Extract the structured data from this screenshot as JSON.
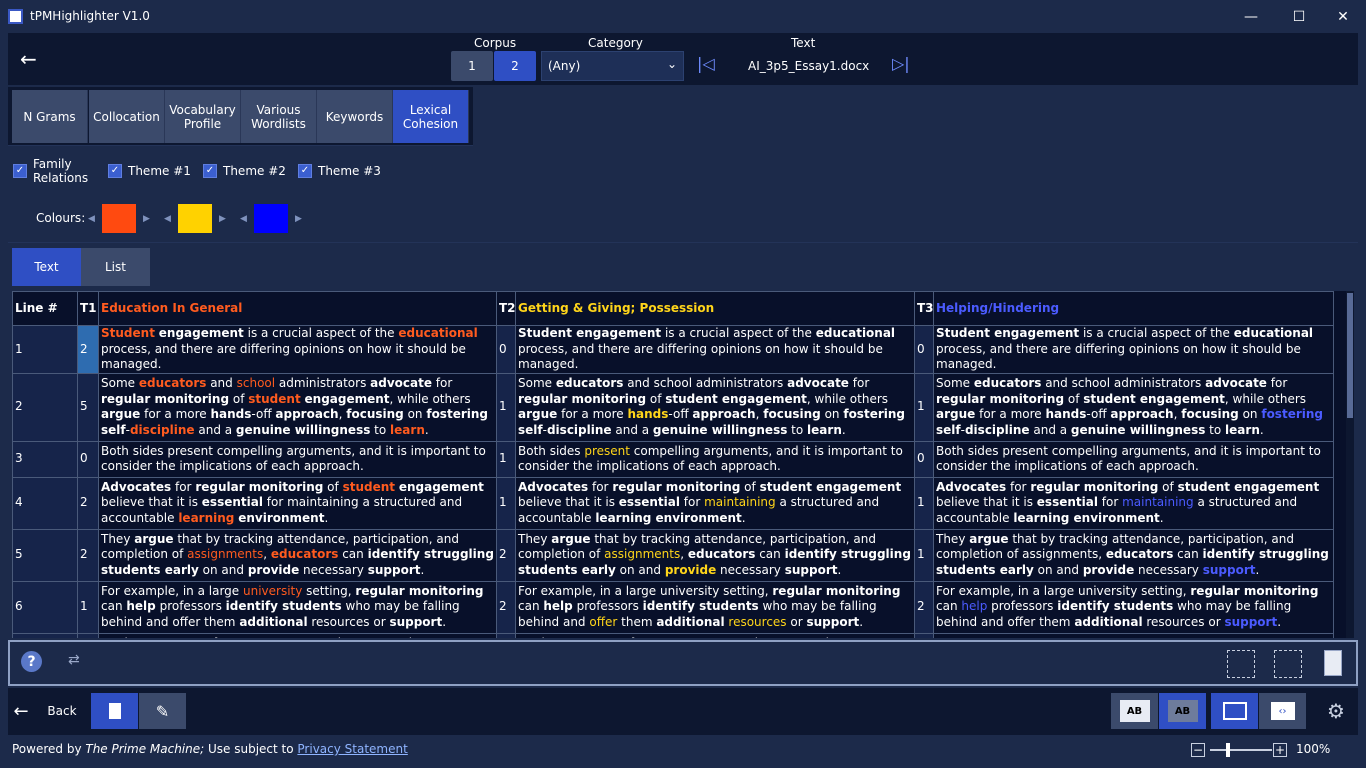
{
  "window": {
    "title": "tPMHighlighter V1.0",
    "minimize": "—",
    "maximize": "☐",
    "close": "✕"
  },
  "top": {
    "back_icon": "←",
    "corpus_label": "Corpus",
    "corpus_buttons": [
      "1",
      "2"
    ],
    "category_label": "Category",
    "category_value": "(Any)",
    "category_chevron": "⌄",
    "text_label": "Text",
    "first_icon": "|◁",
    "last_icon": "▷|",
    "filename": "AI_3p5_Essay1.docx"
  },
  "tabs": [
    "N Grams",
    "Collocation",
    "Vocabulary Profile",
    "Various Wordlists",
    "Keywords",
    "Lexical Cohesion"
  ],
  "options": {
    "family_relations": "Family Relations",
    "theme1": "Theme #1",
    "theme2": "Theme #2",
    "theme3": "Theme #3",
    "colours_label": "Colours:",
    "colours": [
      "#ff4a10",
      "#ffd200",
      "#0000ff"
    ]
  },
  "view_tabs": [
    "Text",
    "List"
  ],
  "table": {
    "headers": {
      "line": "Line #",
      "t1": "T1",
      "t1_name": "Education In General",
      "t2": "T2",
      "t2_name": "Getting & Giving; Possession",
      "t3": "T3",
      "t3_name": "Helping/Hindering"
    },
    "rows": [
      {
        "line": "1",
        "t1": "2",
        "t2": "0",
        "t3": "0"
      },
      {
        "line": "2",
        "t1": "5",
        "t2": "1",
        "t3": "1"
      },
      {
        "line": "3",
        "t1": "0",
        "t2": "1",
        "t3": "0"
      },
      {
        "line": "4",
        "t1": "2",
        "t2": "1",
        "t3": "1"
      },
      {
        "line": "5",
        "t1": "2",
        "t2": "2",
        "t3": "1"
      },
      {
        "line": "6",
        "t1": "1",
        "t2": "2",
        "t3": "2"
      }
    ]
  },
  "bottom": {
    "back_icon": "←",
    "back_label": "Back"
  },
  "status": {
    "powered": "Powered by ",
    "product": "The Prime Machine;",
    "use": " Use subject to ",
    "privacy": "Privacy Statement",
    "zoom_minus": "−",
    "zoom_plus": "+",
    "zoom_value": "100%"
  }
}
